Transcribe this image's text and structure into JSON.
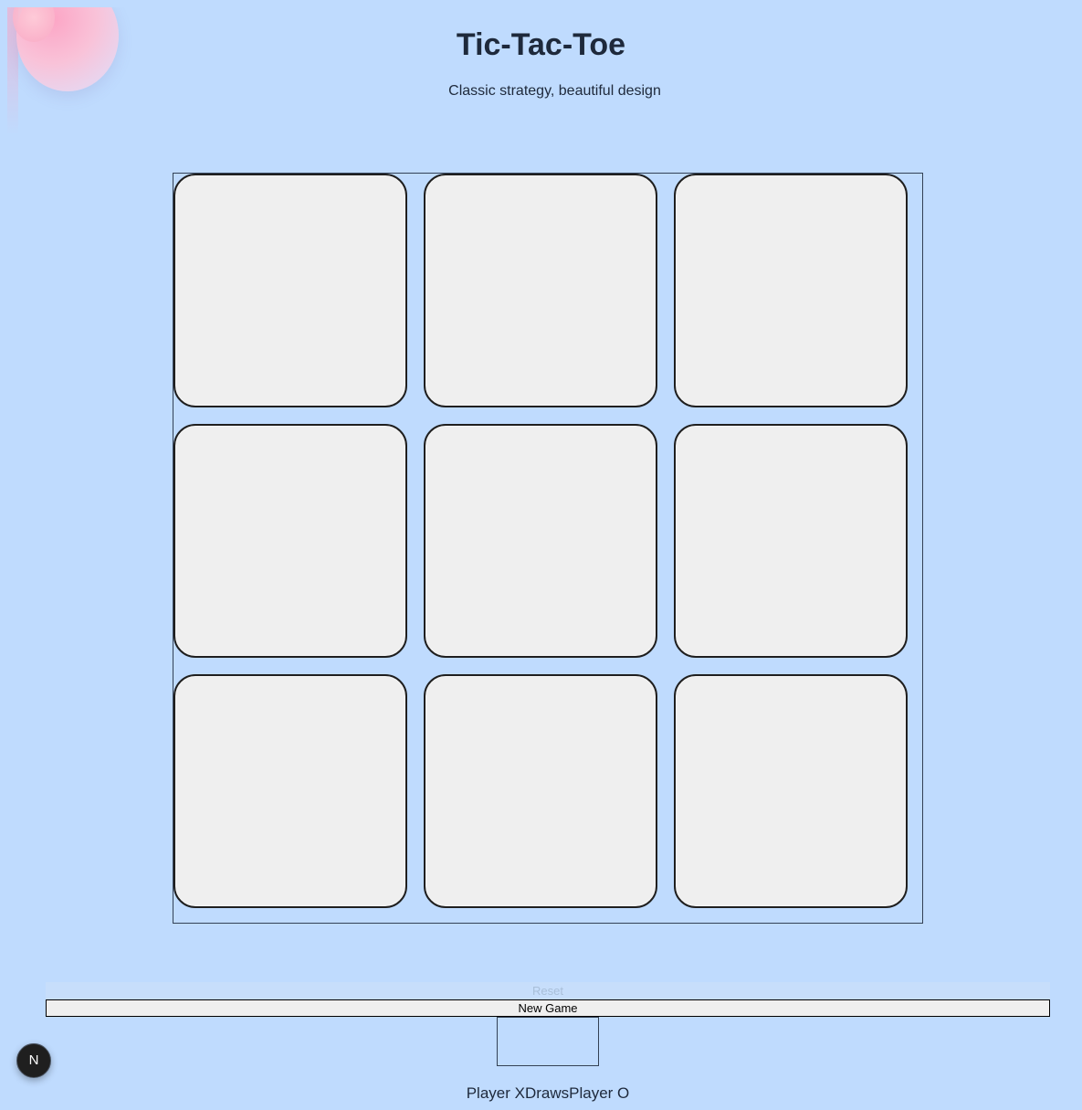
{
  "header": {
    "title": "Tic-Tac-Toe",
    "subtitle": "Classic strategy, beautiful design"
  },
  "board": {
    "cells": [
      "",
      "",
      "",
      "",
      "",
      "",
      "",
      "",
      ""
    ]
  },
  "controls": {
    "reset_label": "Reset",
    "new_game_label": "New Game"
  },
  "scoreboard": {
    "player_x": "Player X",
    "draws": "Draws",
    "player_o": "Player O"
  },
  "nav_badge": {
    "letter": "N"
  },
  "colors": {
    "background": "#bfdbfe",
    "cell": "#efefef",
    "text": "#1e293b"
  }
}
